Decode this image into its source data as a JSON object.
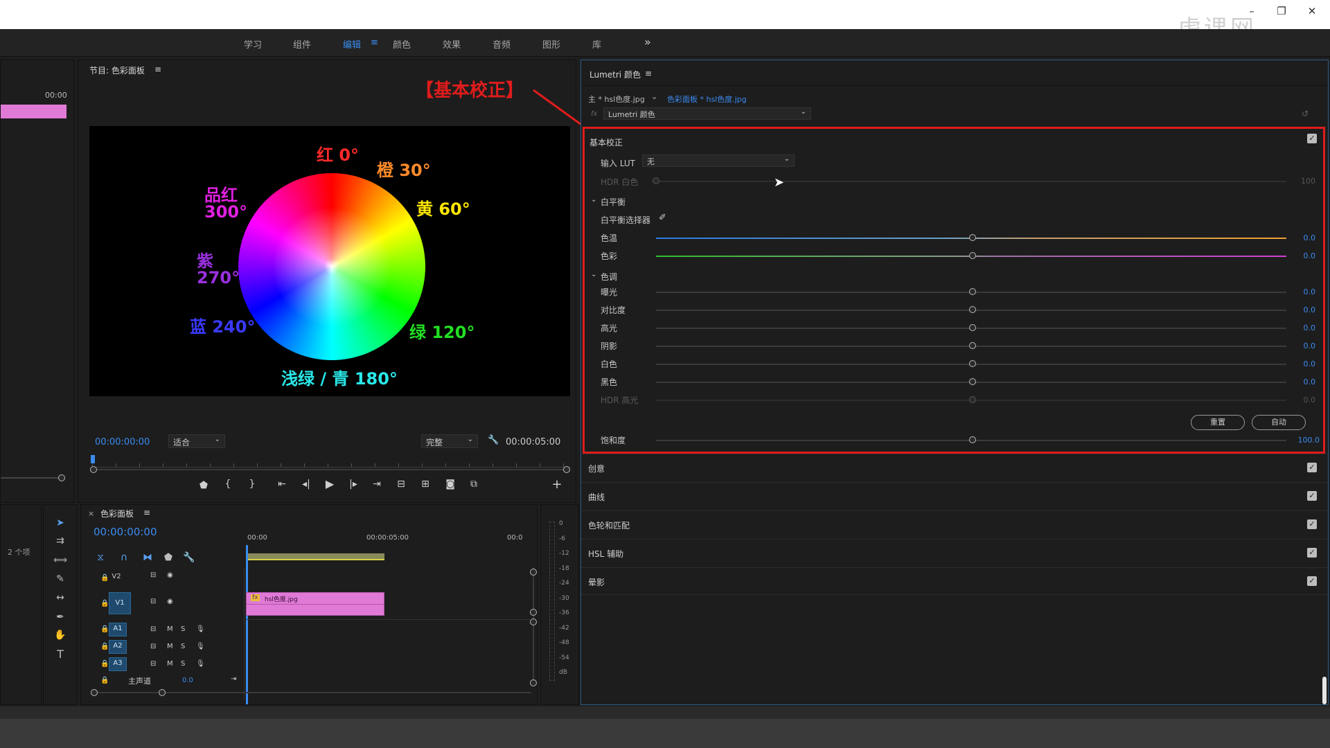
{
  "window": {
    "minimize": "–",
    "restore": "❐",
    "close": "✕",
    "watermark": "虎课网"
  },
  "workspaces": [
    {
      "label": "学习"
    },
    {
      "label": "组件"
    },
    {
      "label": "编辑"
    },
    {
      "label": "颜色"
    },
    {
      "label": "效果"
    },
    {
      "label": "音频"
    },
    {
      "label": "图形"
    },
    {
      "label": "库"
    }
  ],
  "workspace_menu": "≡",
  "workspace_more": "»",
  "left_panel": {
    "time": "00:00",
    "items_count": "2 个项"
  },
  "program_monitor": {
    "title": "节目: 色彩面板",
    "menu": "≡",
    "timecode": "00:00:00:00",
    "fit": "适合",
    "quality": "完整",
    "duration": "00:00:05:00"
  },
  "annotation": {
    "label": "【基本校正】"
  },
  "color_wheel": {
    "labels": [
      {
        "text": "红 0°",
        "color": "#ff2a2a"
      },
      {
        "text": "橙 30°",
        "color": "#ff8a2a"
      },
      {
        "text": "黄 60°",
        "color": "#ffe600"
      },
      {
        "text": "品红",
        "color": "#e020e0"
      },
      {
        "text": "300°",
        "color": "#e020e0"
      },
      {
        "text": "紫",
        "color": "#9a30e0"
      },
      {
        "text": "270°",
        "color": "#9a30e0"
      },
      {
        "text": "蓝 240°",
        "color": "#3a3aff"
      },
      {
        "text": "绿 120°",
        "color": "#22e022"
      },
      {
        "text": "浅绿 / 青 180°",
        "color": "#2ae8e8"
      }
    ]
  },
  "timeline": {
    "title": "色彩面板",
    "menu": "≡",
    "close": "×",
    "timecode": "00:00:00:00",
    "ruler": [
      "00:00",
      "00:00:05:00",
      "00:0"
    ],
    "tracks": [
      "V2",
      "V1",
      "A1",
      "A2",
      "A3"
    ],
    "mix_label": "主声道",
    "mix_value": "0.0",
    "clip_name": "hsl色度.jpg",
    "fx": "fx",
    "m": "M",
    "s": "S"
  },
  "meter": {
    "labels": [
      "0",
      "-6",
      "-12",
      "-18",
      "-24",
      "-30",
      "-36",
      "-42",
      "-48",
      "-54",
      "dB"
    ]
  },
  "lumetri": {
    "title": "Lumetri 颜色",
    "menu": "≡",
    "source_main": "主 * hsl色度.jpg",
    "source_seq": "色彩面板 * hsl色度.jpg",
    "fx": "fx",
    "effect": "Lumetri 颜色",
    "basic": {
      "title": "基本校正",
      "input_lut_label": "输入 LUT",
      "input_lut_value": "无",
      "hdr_white_label": "HDR 白色",
      "hdr_white_value": "100",
      "wb_title": "白平衡",
      "wb_picker": "白平衡选择器",
      "temp_label": "色温",
      "temp_value": "0.0",
      "tint_label": "色彩",
      "tint_value": "0.0",
      "tone_title": "色调",
      "tone_rows": [
        {
          "label": "曝光",
          "value": "0.0"
        },
        {
          "label": "对比度",
          "value": "0.0"
        },
        {
          "label": "高光",
          "value": "0.0"
        },
        {
          "label": "阴影",
          "value": "0.0"
        },
        {
          "label": "白色",
          "value": "0.0"
        },
        {
          "label": "黑色",
          "value": "0.0"
        },
        {
          "label": "HDR 高光",
          "value": "0.0"
        }
      ],
      "reset": "重置",
      "auto": "自动",
      "saturation_label": "饱和度",
      "saturation_value": "100.0"
    },
    "sections": [
      "创意",
      "曲线",
      "色轮和匹配",
      "HSL 辅助",
      "晕影"
    ]
  }
}
